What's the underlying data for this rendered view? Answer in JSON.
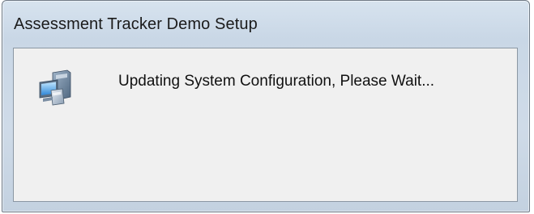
{
  "window": {
    "title": "Assessment Tracker Demo Setup"
  },
  "dialog": {
    "icon": "computer-setup-icon",
    "message": "Updating System Configuration, Please Wait..."
  },
  "colors": {
    "frame": "#c9d7e6",
    "client_background": "#f0f0f0",
    "text": "#111111"
  }
}
